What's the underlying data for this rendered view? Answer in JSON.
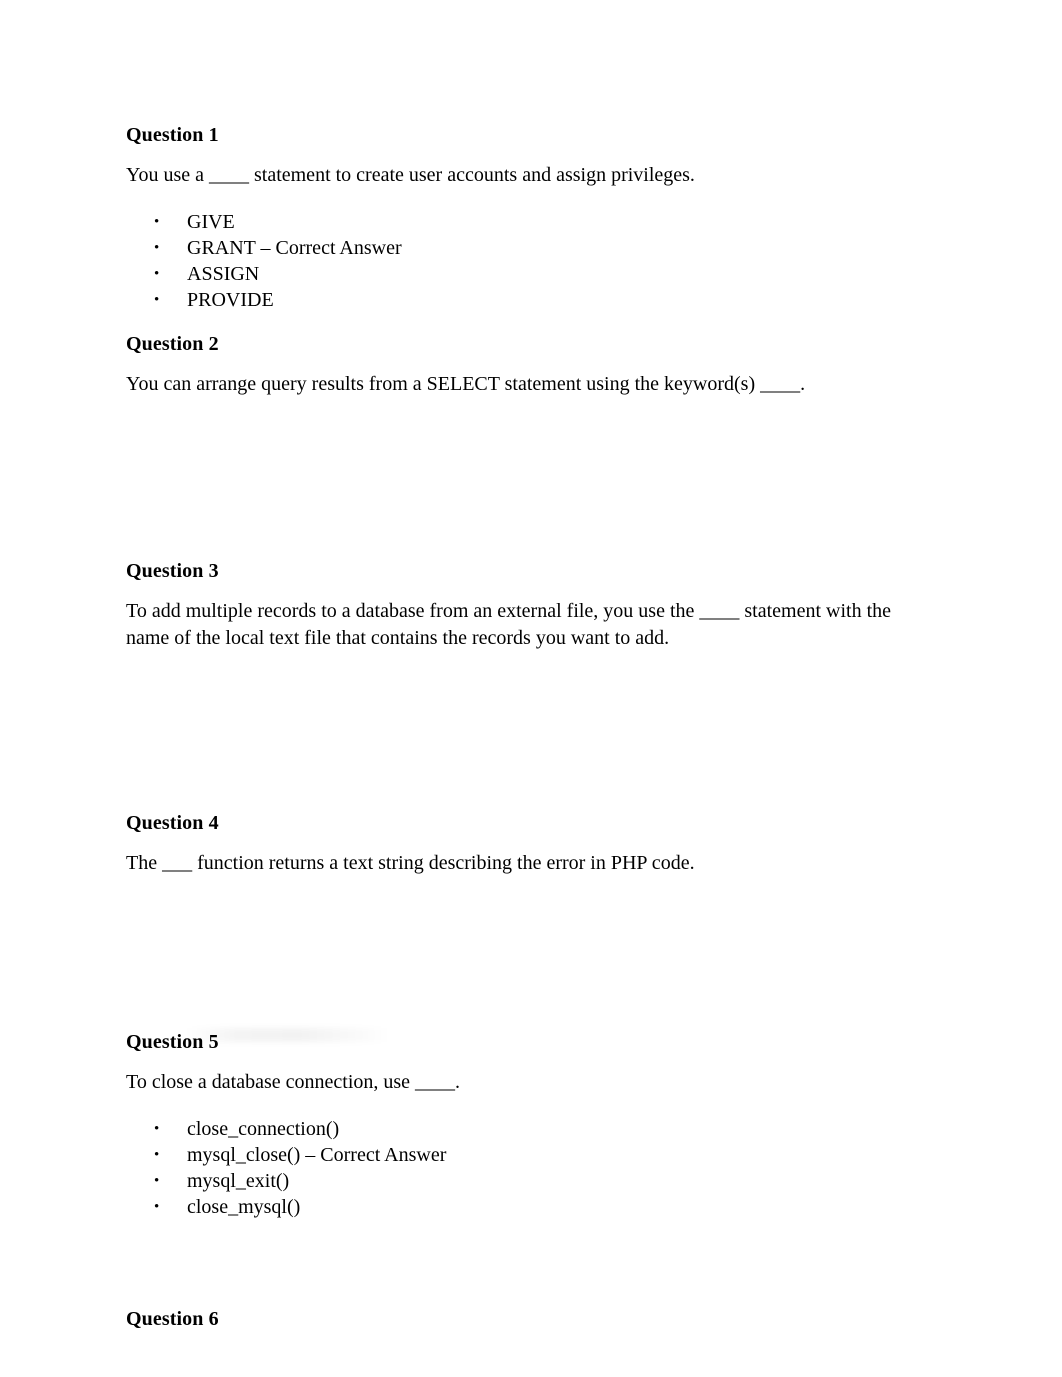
{
  "document": {
    "background_color": "#ffffff",
    "text_color": "#000000",
    "questions": [
      {
        "heading": "Question 1",
        "prompt": "You use a ____ statement to create user accounts and assign privileges.",
        "choices": [
          "GIVE",
          "GRANT – Correct Answer",
          "ASSIGN",
          "PROVIDE"
        ]
      },
      {
        "heading": "Question 2",
        "prompt": "You can arrange query results from a SELECT statement using the keyword(s) ____.",
        "choices": []
      },
      {
        "heading": "Question 3",
        "prompt": "To add multiple records to a database from an external file, you use the ____ statement with the name of the local text file that contains the records you want to add.",
        "choices": []
      },
      {
        "heading": "Question 4",
        "prompt": "The ___ function returns a text string describing the error in PHP code.",
        "choices": []
      },
      {
        "heading": "Question 5",
        "prompt": "To close a database connection, use ____.",
        "choices": [
          "close_connection()",
          "mysql_close() – Correct Answer",
          "mysql_exit()",
          "close_mysql()"
        ]
      },
      {
        "heading": "Question 6",
        "prompt": "",
        "choices": []
      }
    ],
    "bullet_glyph": "•"
  }
}
